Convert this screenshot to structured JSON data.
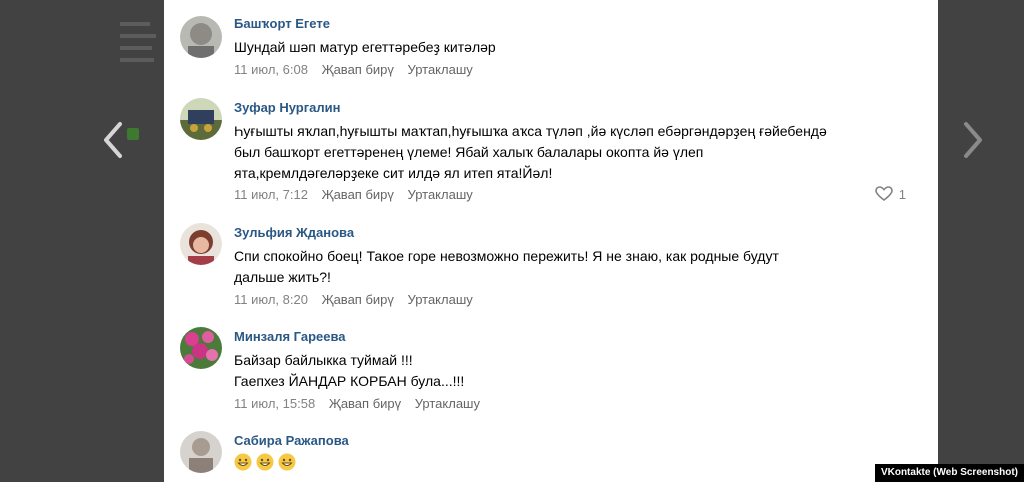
{
  "comments": [
    {
      "author": "Башҡорт Егете",
      "lines": [
        "Шундай шәп матур егеттәребеҙ китәләр"
      ],
      "time": "11 июл, 6:08",
      "reply": "Җавап бирү",
      "share": "Уртаклашу",
      "likes": ""
    },
    {
      "author": "Зуфар Нургалин",
      "lines": [
        "Һуғышты яҡлап,һуғышты маҡтап,һуғышҡа аҡса түләп ,йә күсләп ебәргәндәрҙең ғәйебендә",
        "был башҡорт егеттәренең үлеме! Ябай халыҡ балалары окопта йә үлеп",
        "ята,кремлдәгеләрҙеке сит илдә ял итеп ята!Йәл!"
      ],
      "time": "11 июл, 7:12",
      "reply": "Җавап бирү",
      "share": "Уртаклашу",
      "likes": "1"
    },
    {
      "author": "Зульфия Жданова",
      "lines": [
        "Спи спокойно боец! Такое горе невозможно пережить! Я не знаю, как родные будут",
        "дальше жить?!"
      ],
      "time": "11 июл, 8:20",
      "reply": "Җавап бирү",
      "share": "Уртаклашу",
      "likes": ""
    },
    {
      "author": "Минзаля Гареева",
      "lines": [
        "Байзар байлыкка туймай !!!",
        "Гаепхез ЙАНДАР КОРБАН була...!!!"
      ],
      "time": "11 июл, 15:58",
      "reply": "Җавап бирү",
      "share": "Уртаклашу",
      "likes": ""
    },
    {
      "author": "Сабира Ражапова",
      "lines": [],
      "time": "",
      "reply": "",
      "share": "",
      "likes": ""
    }
  ],
  "icons": {
    "prev": "chevron-left-icon",
    "next": "chevron-right-icon",
    "like": "heart-icon",
    "emoji": "grinning-face-emoji"
  },
  "colors": {
    "author": "#2a5885",
    "meta": "#828282",
    "backdrop": "#424242"
  },
  "watermark": "VKontakte (Web Screenshot)"
}
